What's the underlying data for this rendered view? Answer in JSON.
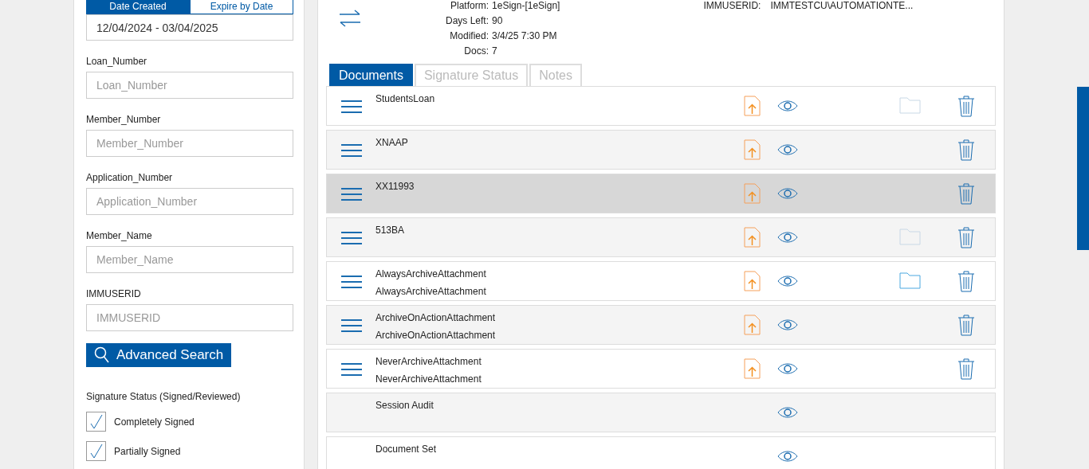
{
  "date_tabs": [
    {
      "label": "Date Created",
      "selected": true
    },
    {
      "label": "Expire by Date",
      "selected": false
    }
  ],
  "date_range": "12/04/2024 - 03/04/2025",
  "fields": [
    {
      "label": "Loan_Number",
      "placeholder": "Loan_Number"
    },
    {
      "label": "Member_Number",
      "placeholder": "Member_Number"
    },
    {
      "label": "Application_Number",
      "placeholder": "Application_Number"
    },
    {
      "label": "Member_Name",
      "placeholder": "Member_Name"
    },
    {
      "label": "IMMUSERID",
      "placeholder": "IMMUSERID"
    }
  ],
  "search_button": "Advanced Search",
  "signature_status": {
    "title": "Signature Status (Signed/Reviewed)",
    "options": [
      {
        "label": "Completely Signed",
        "checked": true
      },
      {
        "label": "Partially Signed",
        "checked": true
      }
    ]
  },
  "details": [
    {
      "label": "Platform:",
      "value": "1eSign-[1eSign]"
    },
    {
      "label": "Days Left:",
      "value": "90"
    },
    {
      "label": "Modified:",
      "value": "3/4/25 7:30 PM"
    },
    {
      "label": "Docs:",
      "value": "7"
    }
  ],
  "immuserid": {
    "label": "IMMUSERID:",
    "value": "IMMTESTCU\\AUTOMATIONTE..."
  },
  "tabs": [
    {
      "label": "Documents",
      "selected": true
    },
    {
      "label": "Signature Status",
      "selected": false
    },
    {
      "label": "Notes",
      "selected": false
    }
  ],
  "documents": [
    {
      "lines": [
        "StudentsLoan"
      ],
      "menu": true,
      "upload": true,
      "folder": true,
      "folder_active": false,
      "trash": true,
      "selected": false
    },
    {
      "lines": [
        "XNAAP"
      ],
      "menu": true,
      "upload": true,
      "folder": false,
      "trash": true,
      "selected": false
    },
    {
      "lines": [
        "XX11993"
      ],
      "menu": true,
      "upload": true,
      "folder": false,
      "trash": true,
      "selected": true
    },
    {
      "lines": [
        "513BA"
      ],
      "menu": true,
      "upload": true,
      "folder": true,
      "folder_active": false,
      "trash": true,
      "selected": false
    },
    {
      "lines": [
        "AlwaysArchiveAttachment",
        "AlwaysArchiveAttachment"
      ],
      "menu": true,
      "upload": true,
      "folder": true,
      "folder_active": true,
      "trash": true,
      "selected": false
    },
    {
      "lines": [
        "ArchiveOnActionAttachment",
        "ArchiveOnActionAttachment"
      ],
      "menu": true,
      "upload": true,
      "folder": false,
      "trash": true,
      "selected": false
    },
    {
      "lines": [
        "NeverArchiveAttachment",
        "NeverArchiveAttachment"
      ],
      "menu": true,
      "upload": true,
      "folder": false,
      "trash": true,
      "selected": false
    },
    {
      "lines": [
        "Session Audit"
      ],
      "menu": false,
      "upload": false,
      "folder": false,
      "trash": false,
      "selected": false
    },
    {
      "lines": [
        "Document Set"
      ],
      "menu": false,
      "upload": false,
      "folder": false,
      "trash": false,
      "selected": false
    }
  ]
}
